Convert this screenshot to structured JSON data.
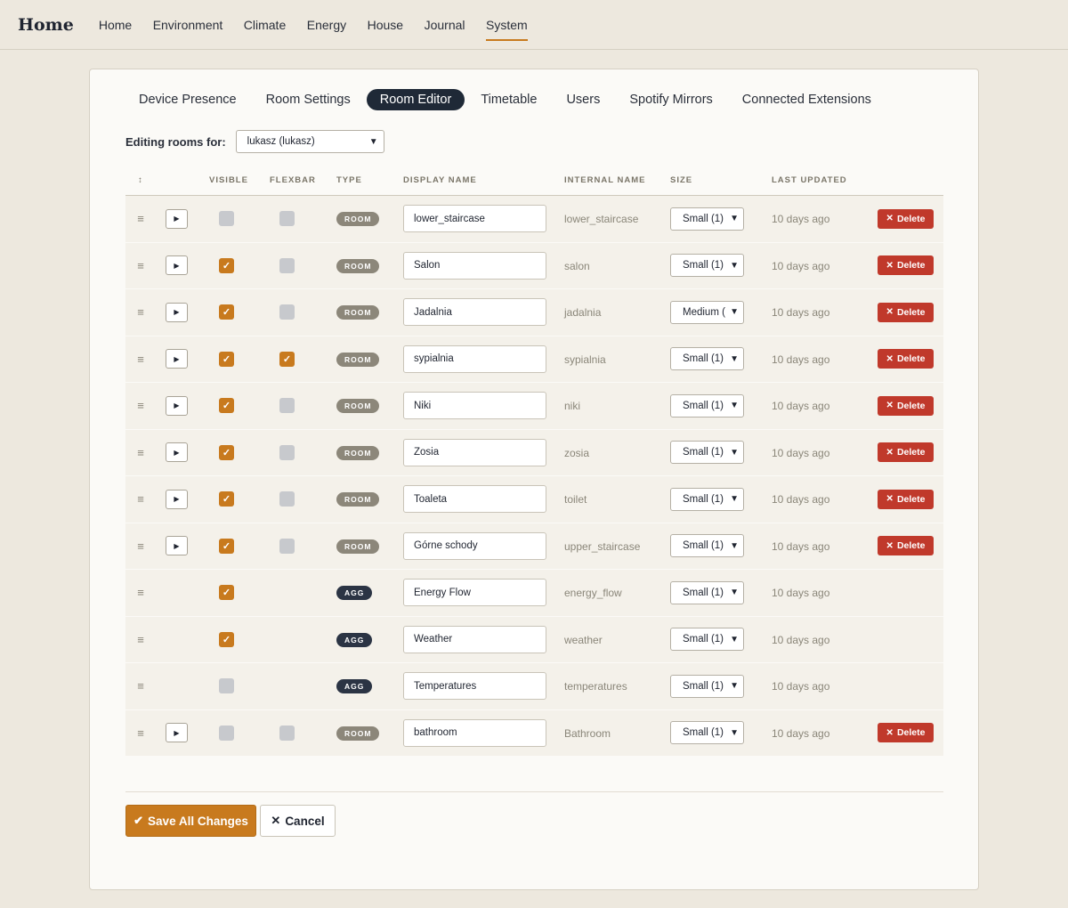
{
  "brand": "Home",
  "nav": [
    "Home",
    "Environment",
    "Climate",
    "Energy",
    "House",
    "Journal",
    "System"
  ],
  "nav_active": "System",
  "tabs": [
    "Device Presence",
    "Room Settings",
    "Room Editor",
    "Timetable",
    "Users",
    "Spotify Mirrors",
    "Connected Extensions"
  ],
  "tab_active": "Room Editor",
  "filter": {
    "label": "Editing rooms for:",
    "value": "lukasz (lukasz)"
  },
  "columns": {
    "drag": "↕",
    "visible": "Visible",
    "flexbar": "Flexbar",
    "type": "Type",
    "display_name": "Display Name",
    "internal_name": "Internal Name",
    "size": "Size",
    "last_updated": "Last Updated"
  },
  "delete_label": "Delete",
  "rows": [
    {
      "play": true,
      "visible": false,
      "flexbar": false,
      "type": "ROOM",
      "display": "lower_staircase",
      "internal": "lower_staircase",
      "size": "Small (1)",
      "updated": "10 days ago",
      "deletable": true
    },
    {
      "play": true,
      "visible": true,
      "flexbar": false,
      "type": "ROOM",
      "display": "Salon",
      "internal": "salon",
      "size": "Small (1)",
      "updated": "10 days ago",
      "deletable": true
    },
    {
      "play": true,
      "visible": true,
      "flexbar": false,
      "type": "ROOM",
      "display": "Jadalnia",
      "internal": "jadalnia",
      "size": "Medium (",
      "updated": "10 days ago",
      "deletable": true
    },
    {
      "play": true,
      "visible": true,
      "flexbar": true,
      "type": "ROOM",
      "display": "sypialnia",
      "internal": "sypialnia",
      "size": "Small (1)",
      "updated": "10 days ago",
      "deletable": true
    },
    {
      "play": true,
      "visible": true,
      "flexbar": false,
      "type": "ROOM",
      "display": "Niki",
      "internal": "niki",
      "size": "Small (1)",
      "updated": "10 days ago",
      "deletable": true
    },
    {
      "play": true,
      "visible": true,
      "flexbar": false,
      "type": "ROOM",
      "display": "Zosia",
      "internal": "zosia",
      "size": "Small (1)",
      "updated": "10 days ago",
      "deletable": true
    },
    {
      "play": true,
      "visible": true,
      "flexbar": false,
      "type": "ROOM",
      "display": "Toaleta",
      "internal": "toilet",
      "size": "Small (1)",
      "updated": "10 days ago",
      "deletable": true
    },
    {
      "play": true,
      "visible": true,
      "flexbar": false,
      "type": "ROOM",
      "display": "Górne schody",
      "internal": "upper_staircase",
      "size": "Small (1)",
      "updated": "10 days ago",
      "deletable": true
    },
    {
      "play": false,
      "visible": true,
      "flexbar": null,
      "type": "AGG",
      "display": "Energy Flow",
      "internal": "energy_flow",
      "size": "Small (1)",
      "updated": "10 days ago",
      "deletable": false
    },
    {
      "play": false,
      "visible": true,
      "flexbar": null,
      "type": "AGG",
      "display": "Weather",
      "internal": "weather",
      "size": "Small (1)",
      "updated": "10 days ago",
      "deletable": false
    },
    {
      "play": false,
      "visible": false,
      "flexbar": null,
      "type": "AGG",
      "display": "Temperatures",
      "internal": "temperatures",
      "size": "Small (1)",
      "updated": "10 days ago",
      "deletable": false
    },
    {
      "play": true,
      "visible": false,
      "flexbar": false,
      "type": "ROOM",
      "display": "bathroom",
      "internal": "Bathroom",
      "size": "Small (1)",
      "updated": "10 days ago",
      "deletable": true
    }
  ],
  "actions": {
    "save": "Save All Changes",
    "cancel": "Cancel"
  },
  "colors": {
    "accent": "#c87a1e",
    "dark": "#1f2937",
    "danger": "#c0392b",
    "background": "#ede8de"
  }
}
